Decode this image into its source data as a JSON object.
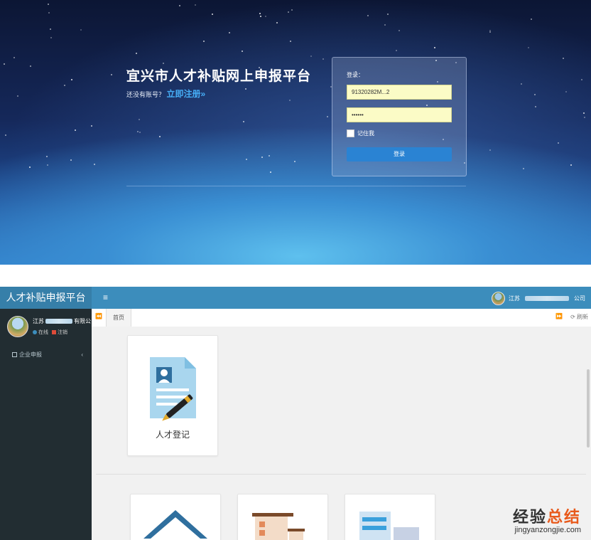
{
  "login": {
    "title": "宜兴市人才补贴网上申报平台",
    "register_prompt": "还没有账号？",
    "register_link": "立即注册»",
    "form": {
      "heading": "登录：",
      "username_value": "91320282M...2",
      "password_value": "••••••",
      "remember_label": "记住我",
      "submit_label": "登录"
    }
  },
  "admin": {
    "brand": "人才补贴申报平台",
    "menu_icon": "≡",
    "top_user": {
      "prefix": "江苏",
      "suffix": "公司"
    },
    "sidebar": {
      "user": {
        "name_prefix": "江苏",
        "name_suffix": "有限公",
        "status_online": "在线",
        "logout": "注销"
      },
      "menu": [
        {
          "label": "企业申报",
          "icon": "form-icon"
        }
      ]
    },
    "tabs": {
      "home": "首页",
      "prev_icon": "⏪",
      "next_icon": "⏩",
      "refresh_label": "刷新"
    },
    "cards": [
      {
        "label": "人才登记",
        "icon": "talent-register-icon"
      }
    ]
  },
  "watermark": {
    "cn_a": "经验",
    "cn_b": "总结",
    "url": "jingyanzongjie.com"
  },
  "colors": {
    "topbar": "#3c8dbc",
    "sidebar": "#222d32",
    "login_button": "#2a83d3",
    "watermark_orange": "#e85a1c"
  }
}
